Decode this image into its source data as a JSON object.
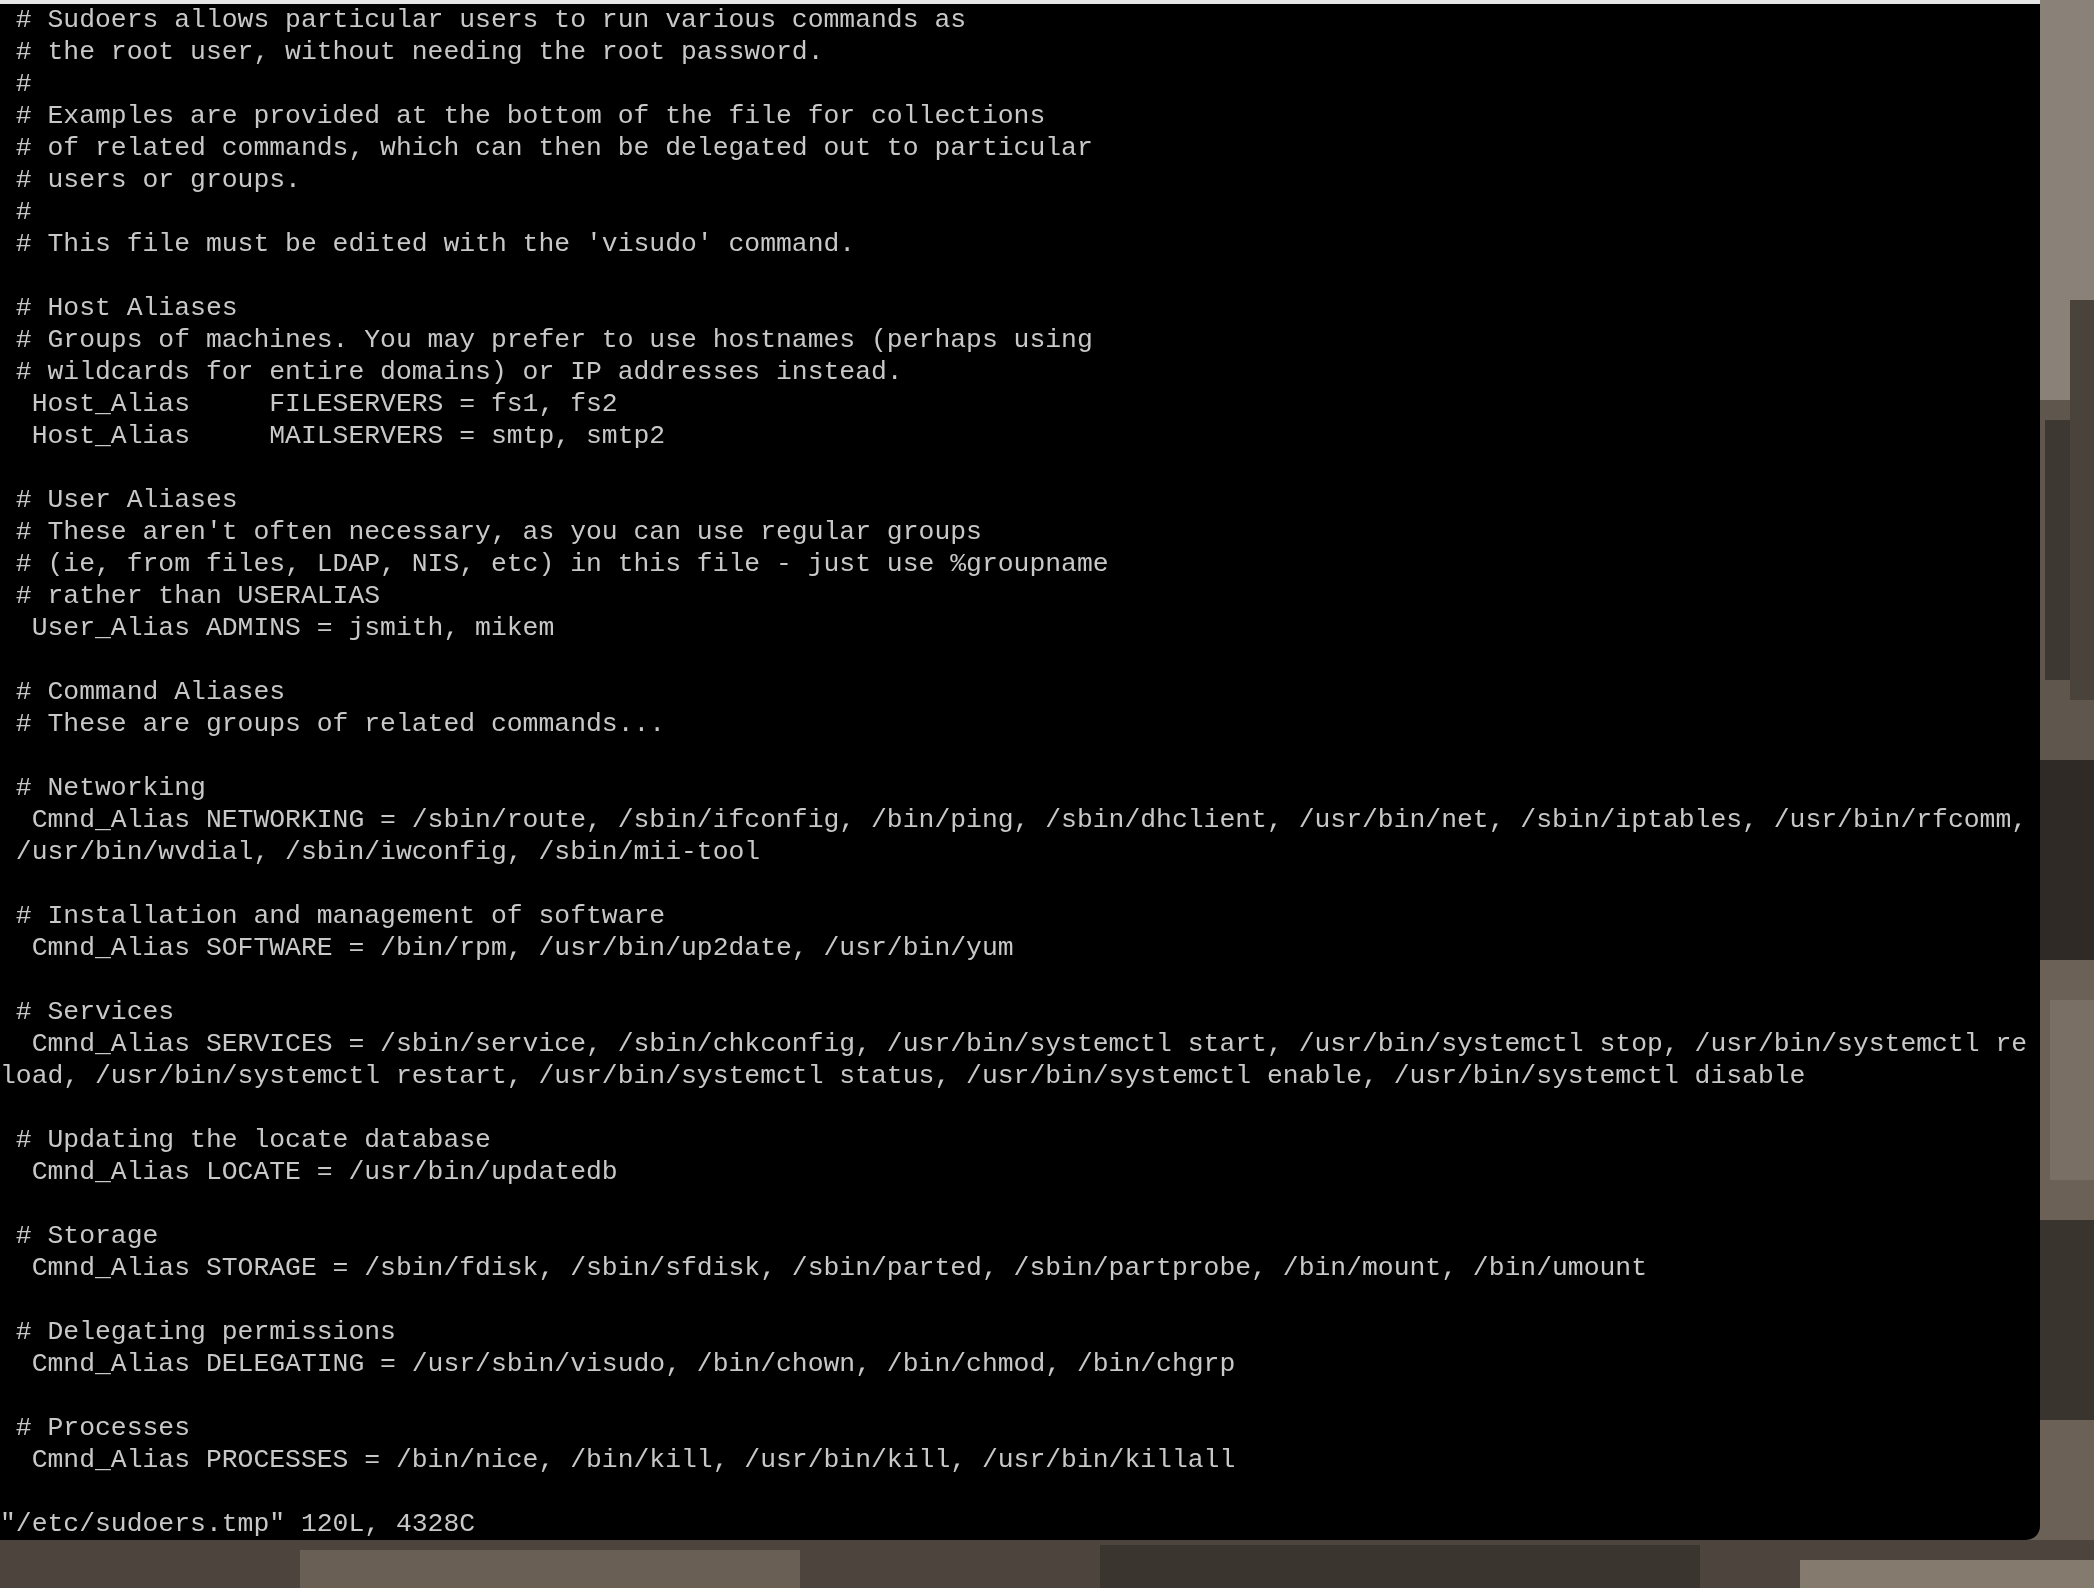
{
  "terminal": {
    "blocks": [
      {
        "lines": [
          " # Sudoers allows particular users to run various commands as",
          " # the root user, without needing the root password.",
          " #",
          " # Examples are provided at the bottom of the file for collections",
          " # of related commands, which can then be delegated out to particular",
          " # users or groups.",
          " #",
          " # This file must be edited with the 'visudo' command."
        ]
      },
      {
        "lines": [
          " # Host Aliases",
          " # Groups of machines. You may prefer to use hostnames (perhaps using",
          " # wildcards for entire domains) or IP addresses instead.",
          "  Host_Alias     FILESERVERS = fs1, fs2",
          "  Host_Alias     MAILSERVERS = smtp, smtp2"
        ]
      },
      {
        "lines": [
          " # User Aliases",
          " # These aren't often necessary, as you can use regular groups",
          " # (ie, from files, LDAP, NIS, etc) in this file - just use %groupname",
          " # rather than USERALIAS",
          "  User_Alias ADMINS = jsmith, mikem"
        ]
      },
      {
        "lines": [
          " # Command Aliases",
          " # These are groups of related commands..."
        ]
      },
      {
        "lines": [
          " # Networking",
          "  Cmnd_Alias NETWORKING = /sbin/route, /sbin/ifconfig, /bin/ping, /sbin/dhclient, /usr/bin/net, /sbin/iptables, /usr/bin/rfcomm,",
          " /usr/bin/wvdial, /sbin/iwconfig, /sbin/mii-tool"
        ]
      },
      {
        "lines": [
          " # Installation and management of software",
          "  Cmnd_Alias SOFTWARE = /bin/rpm, /usr/bin/up2date, /usr/bin/yum"
        ]
      },
      {
        "lines": [
          " # Services",
          "  Cmnd_Alias SERVICES = /sbin/service, /sbin/chkconfig, /usr/bin/systemctl start, /usr/bin/systemctl stop, /usr/bin/systemctl re",
          "load, /usr/bin/systemctl restart, /usr/bin/systemctl status, /usr/bin/systemctl enable, /usr/bin/systemctl disable"
        ]
      },
      {
        "lines": [
          " # Updating the locate database",
          "  Cmnd_Alias LOCATE = /usr/bin/updatedb"
        ]
      },
      {
        "lines": [
          " # Storage",
          "  Cmnd_Alias STORAGE = /sbin/fdisk, /sbin/sfdisk, /sbin/parted, /sbin/partprobe, /bin/mount, /bin/umount"
        ]
      },
      {
        "lines": [
          " # Delegating permissions",
          "  Cmnd_Alias DELEGATING = /usr/sbin/visudo, /bin/chown, /bin/chmod, /bin/chgrp"
        ]
      },
      {
        "lines": [
          " # Processes",
          "  Cmnd_Alias PROCESSES = /bin/nice, /bin/kill, /usr/bin/kill, /usr/bin/killall"
        ]
      }
    ],
    "status_line": "\"/etc/sudoers.tmp\" 120L, 4328C"
  }
}
